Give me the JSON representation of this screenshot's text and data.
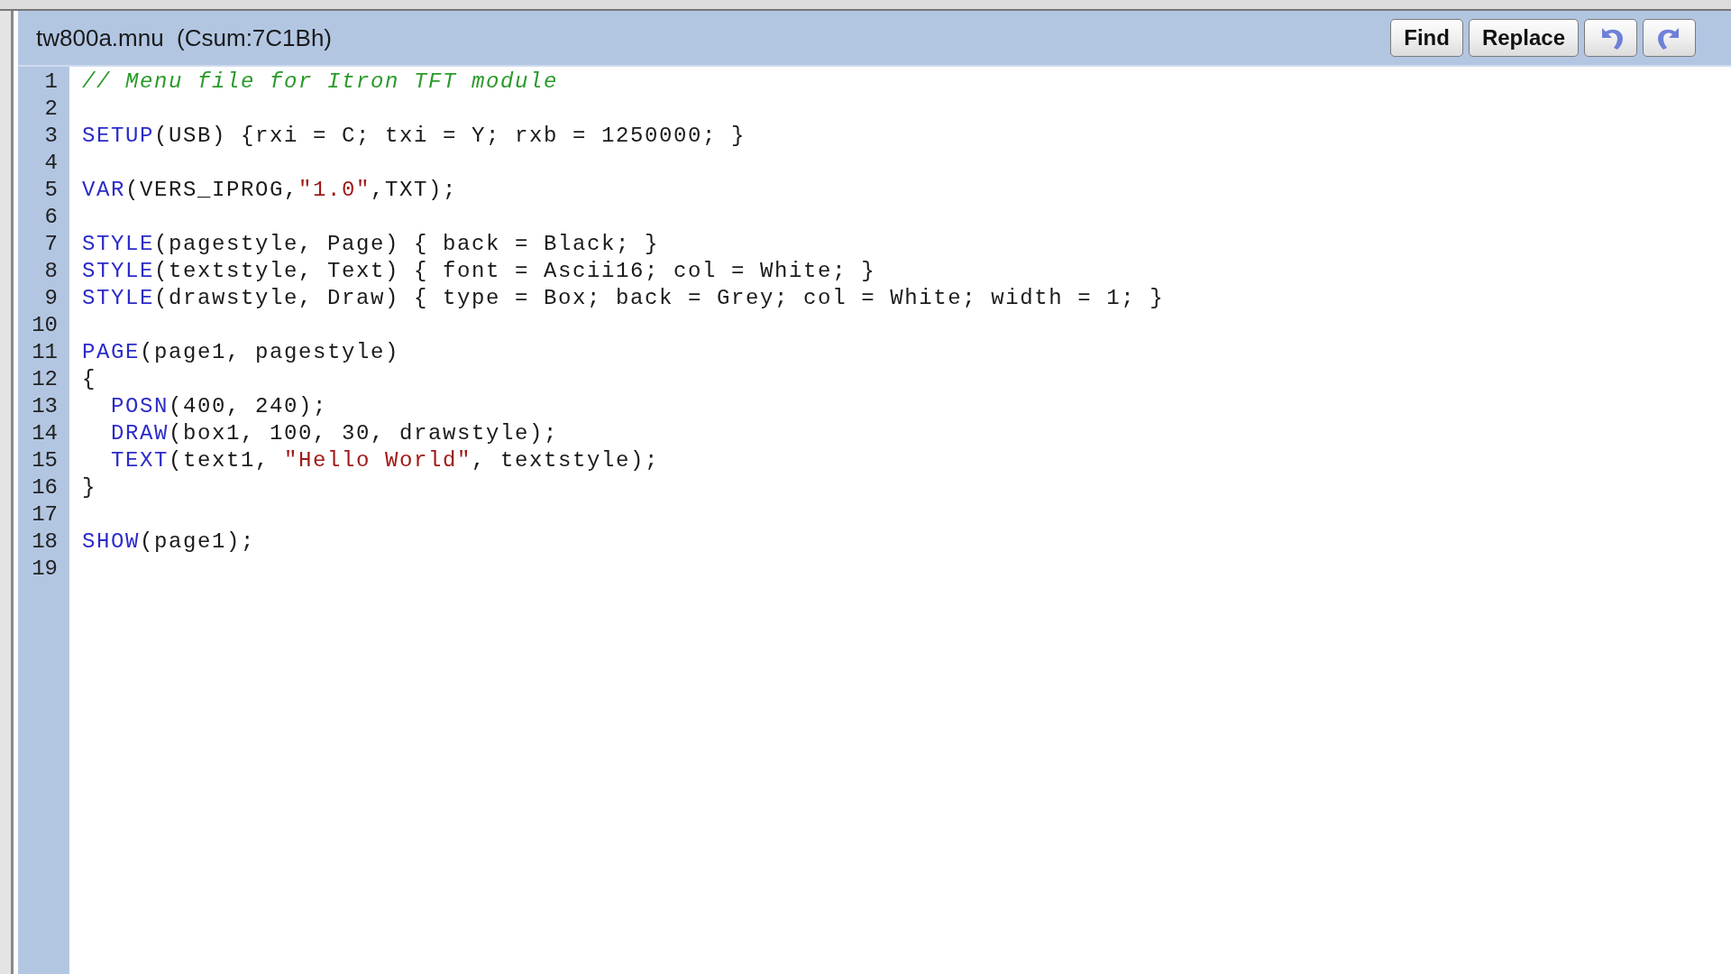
{
  "editor": {
    "title": "tw800a.mnu  (Csum:7C1Bh)",
    "buttons": [
      {
        "kind": "text",
        "label": "Find"
      },
      {
        "kind": "text",
        "label": "Replace"
      },
      {
        "kind": "undo"
      },
      {
        "kind": "redo"
      }
    ],
    "lines": [
      {
        "number": "1",
        "tokens": [
          {
            "kind": "comment",
            "text": "// Menu file for Itron TFT module"
          }
        ]
      },
      {
        "number": "2"
      },
      {
        "number": "3",
        "tokens": [
          {
            "kind": "keyword",
            "text": "SETUP"
          },
          {
            "kind": "plain",
            "text": "(USB) {rxi = C; txi = Y; rxb = 1250000; }"
          }
        ]
      },
      {
        "number": "4"
      },
      {
        "number": "5",
        "tokens": [
          {
            "kind": "keyword",
            "text": "VAR"
          },
          {
            "kind": "plain",
            "text": "(VERS_IPROG,"
          },
          {
            "kind": "string",
            "text": "\"1.0\""
          },
          {
            "kind": "plain",
            "text": ",TXT);"
          }
        ]
      },
      {
        "number": "6"
      },
      {
        "number": "7",
        "tokens": [
          {
            "kind": "keyword",
            "text": "STYLE"
          },
          {
            "kind": "plain",
            "text": "(pagestyle, Page) { back = Black; }"
          }
        ]
      },
      {
        "number": "8",
        "tokens": [
          {
            "kind": "keyword",
            "text": "STYLE"
          },
          {
            "kind": "plain",
            "text": "(textstyle, Text) { font = Ascii16; col = White; }"
          }
        ]
      },
      {
        "number": "9",
        "tokens": [
          {
            "kind": "keyword",
            "text": "STYLE"
          },
          {
            "kind": "plain",
            "text": "(drawstyle, Draw) { type = Box; back = Grey; col = White; width = 1; }"
          }
        ]
      },
      {
        "number": "10"
      },
      {
        "number": "11",
        "tokens": [
          {
            "kind": "keyword",
            "text": "PAGE"
          },
          {
            "kind": "plain",
            "text": "(page1, pagestyle)"
          }
        ]
      },
      {
        "number": "12",
        "tokens": [
          {
            "kind": "plain",
            "text": "{"
          }
        ]
      },
      {
        "number": "13",
        "tokens": [
          {
            "kind": "keyword",
            "text": "  POSN"
          },
          {
            "kind": "plain",
            "text": "(400, 240);"
          }
        ]
      },
      {
        "number": "14",
        "tokens": [
          {
            "kind": "keyword",
            "text": "  DRAW"
          },
          {
            "kind": "plain",
            "text": "(box1, 100, 30, drawstyle);"
          }
        ]
      },
      {
        "number": "15",
        "tokens": [
          {
            "kind": "keyword",
            "text": "  TEXT"
          },
          {
            "kind": "plain",
            "text": "(text1, "
          },
          {
            "kind": "string",
            "text": "\"Hello World\""
          },
          {
            "kind": "plain",
            "text": ", textstyle);"
          }
        ]
      },
      {
        "number": "16",
        "tokens": [
          {
            "kind": "plain",
            "text": "}"
          }
        ]
      },
      {
        "number": "17"
      },
      {
        "number": "18",
        "tokens": [
          {
            "kind": "keyword",
            "text": "SHOW"
          },
          {
            "kind": "plain",
            "text": "(page1);"
          }
        ]
      },
      {
        "number": "19"
      }
    ]
  }
}
